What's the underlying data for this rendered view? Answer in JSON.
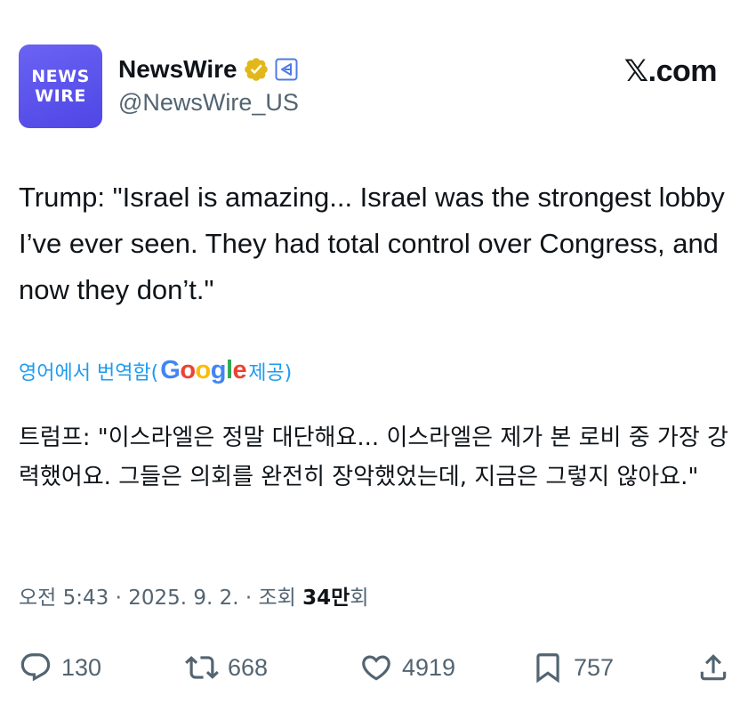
{
  "account": {
    "avatar_line1": "NEWS",
    "avatar_line2": "WIRE",
    "display_name": "NewsWire",
    "handle": "@NewsWire_US",
    "verified_icon": "verified-gold-badge-icon",
    "affiliate_icon": "affiliate-badge-icon"
  },
  "site_logo": "𝕏.com",
  "tweet": {
    "text": "Trump: \"Israel is amazing... Israel was the strongest lobby I’ve ever seen. They had total control over Congress, and now they don’t.\""
  },
  "translation": {
    "prefix": "영어에서 번역함(",
    "google_logo": "Google",
    "suffix": " 제공)",
    "text": "트럼프: \"이스라엘은 정말 대단해요... 이스라엘은 제가 본 로비 중 가장 강력했어요. 그들은 의회를 완전히 장악했었는데, 지금은 그렇지 않아요.\""
  },
  "meta": {
    "time": "오전 5:43",
    "date": "2025. 9. 2.",
    "views_label": "조회",
    "views_count": "34만",
    "views_suffix": "회",
    "separator": " · "
  },
  "actions": {
    "replies": "130",
    "reposts": "668",
    "likes": "4919",
    "bookmarks": "757"
  },
  "colors": {
    "accent": "#1d9bf0",
    "text": "#0f1419",
    "secondary": "#536471",
    "avatar_bg": "#5b54ee",
    "verified_gold": "#e2b719"
  }
}
